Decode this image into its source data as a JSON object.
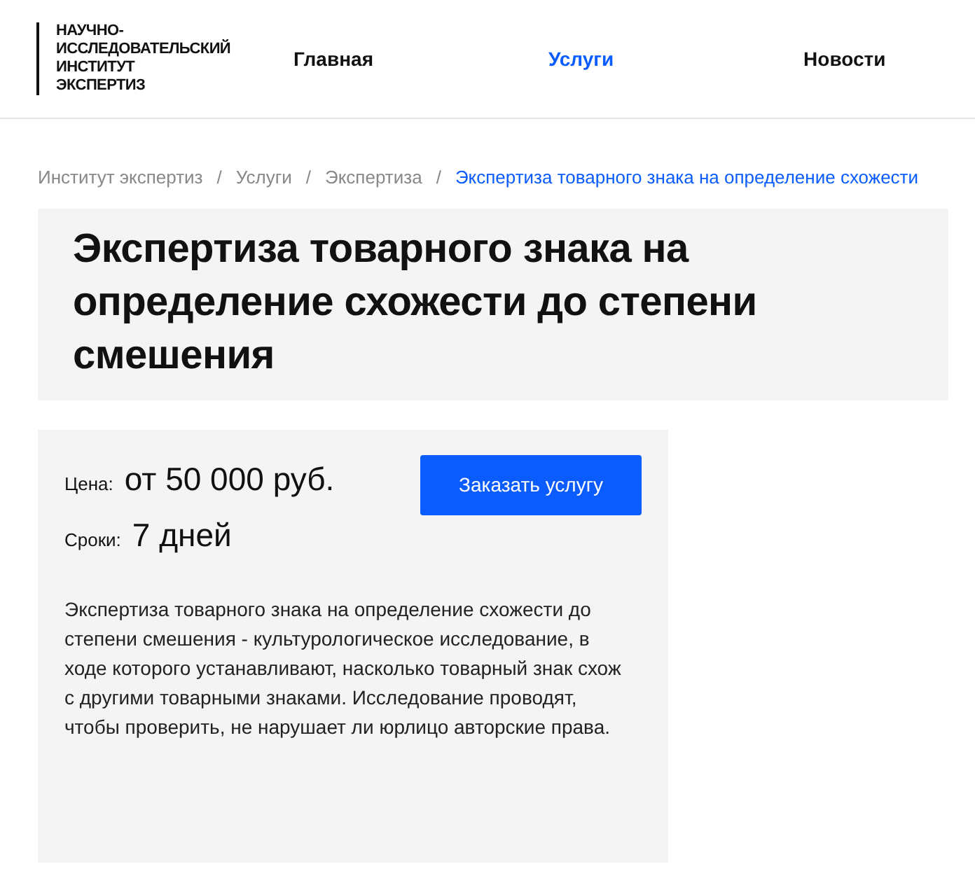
{
  "logo": {
    "lines": [
      "НАУЧНО-",
      "ИССЛЕДОВАТЕЛЬСКИЙ",
      "ИНСТИТУТ",
      "ЭКСПЕРТИЗ"
    ]
  },
  "nav": [
    {
      "label": "Главная",
      "selected": false
    },
    {
      "label": "Услуги",
      "selected": true
    },
    {
      "label": "Новости",
      "selected": false
    }
  ],
  "breadcrumbs": [
    {
      "label": "Институт экспертиз",
      "current": false
    },
    {
      "label": "Услуги",
      "current": false
    },
    {
      "label": "Экспертиза",
      "current": false
    },
    {
      "label": "Экспертиза товарного знака на определение схожести",
      "current": true
    }
  ],
  "separator": "/",
  "title": "Экспертиза товарного знака на определение схожести до степени смешения",
  "price": {
    "label": "Цена:",
    "value": "от 50 000 руб."
  },
  "term": {
    "label": "Сроки:",
    "value": "7 дней"
  },
  "order_button": "Заказать услугу",
  "description": "Экспертиза товарного знака на определение схожести до степени смешения - культурологическое исследование, в ходе которого устанавливают, насколько товарный знак схож с другими товарными знаками. Исследование проводят, чтобы проверить, не нарушает ли юрлицо авторские права."
}
